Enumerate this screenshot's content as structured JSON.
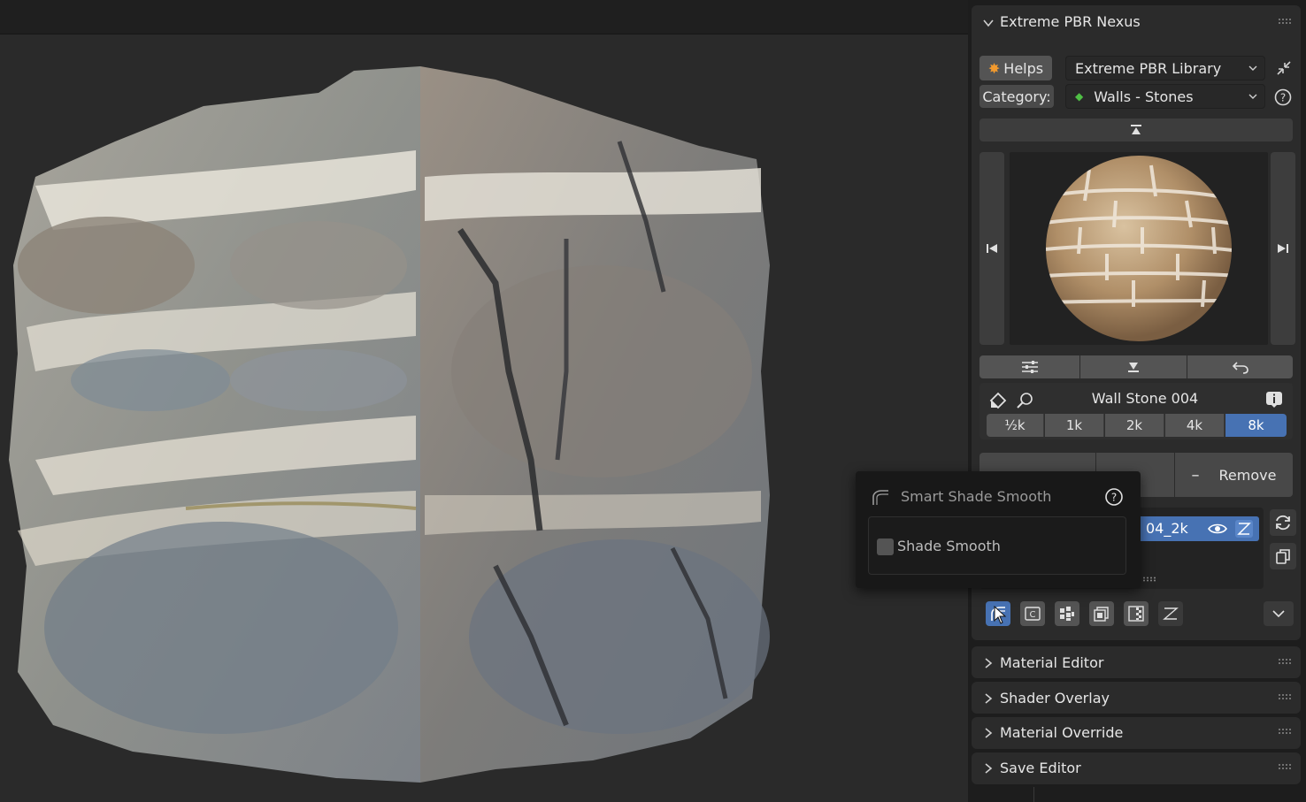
{
  "panel": {
    "title": "Extreme PBR Nexus",
    "helps_label": "Helps",
    "library_select": "Extreme PBR Library",
    "category_label": "Category:",
    "category_select": "Walls - Stones",
    "material_name": "Wall Stone 004",
    "resolutions": [
      "½k",
      "1k",
      "2k",
      "4k",
      "8k"
    ],
    "active_resolution": "8k",
    "remove_label": "Remove",
    "material_slot": "04_2k"
  },
  "popover": {
    "title": "Smart Shade Smooth",
    "checkbox_label": "Shade Smooth",
    "checked": false
  },
  "sections": [
    {
      "label": "Material Editor"
    },
    {
      "label": "Shader Overlay"
    },
    {
      "label": "Material Override"
    },
    {
      "label": "Save Editor"
    }
  ],
  "toolbar": {
    "icons": [
      "shade-smooth-icon",
      "c-box-icon",
      "grid-icon",
      "stack-icon",
      "checker-icon",
      "hatch-icon"
    ]
  },
  "colors": {
    "accent": "#4772b3",
    "panel_bg": "#2b2b2b",
    "button_bg": "#545454"
  }
}
